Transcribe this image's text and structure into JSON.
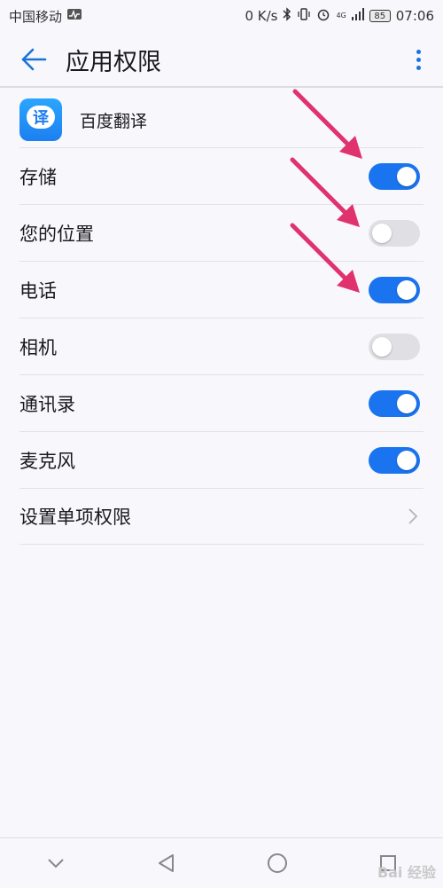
{
  "status_bar": {
    "carrier": "中国移动",
    "speed": "0 K/s",
    "network": "4G",
    "battery": "85",
    "time": "07:06"
  },
  "header": {
    "title": "应用权限"
  },
  "app": {
    "name": "百度翻译",
    "icon_glyph": "译",
    "icon_color": "#1d7ff0"
  },
  "permissions": [
    {
      "label": "存储",
      "enabled": true
    },
    {
      "label": "您的位置",
      "enabled": false
    },
    {
      "label": "电话",
      "enabled": true
    },
    {
      "label": "相机",
      "enabled": false
    },
    {
      "label": "通讯录",
      "enabled": true
    },
    {
      "label": "麦克风",
      "enabled": true
    }
  ],
  "settings_row": {
    "label": "设置单项权限"
  },
  "colors": {
    "accent": "#1a74f0",
    "toggle_off": "#e0dfe4",
    "annotation_arrow": "#e0336e"
  },
  "watermark": "Bai 经验"
}
